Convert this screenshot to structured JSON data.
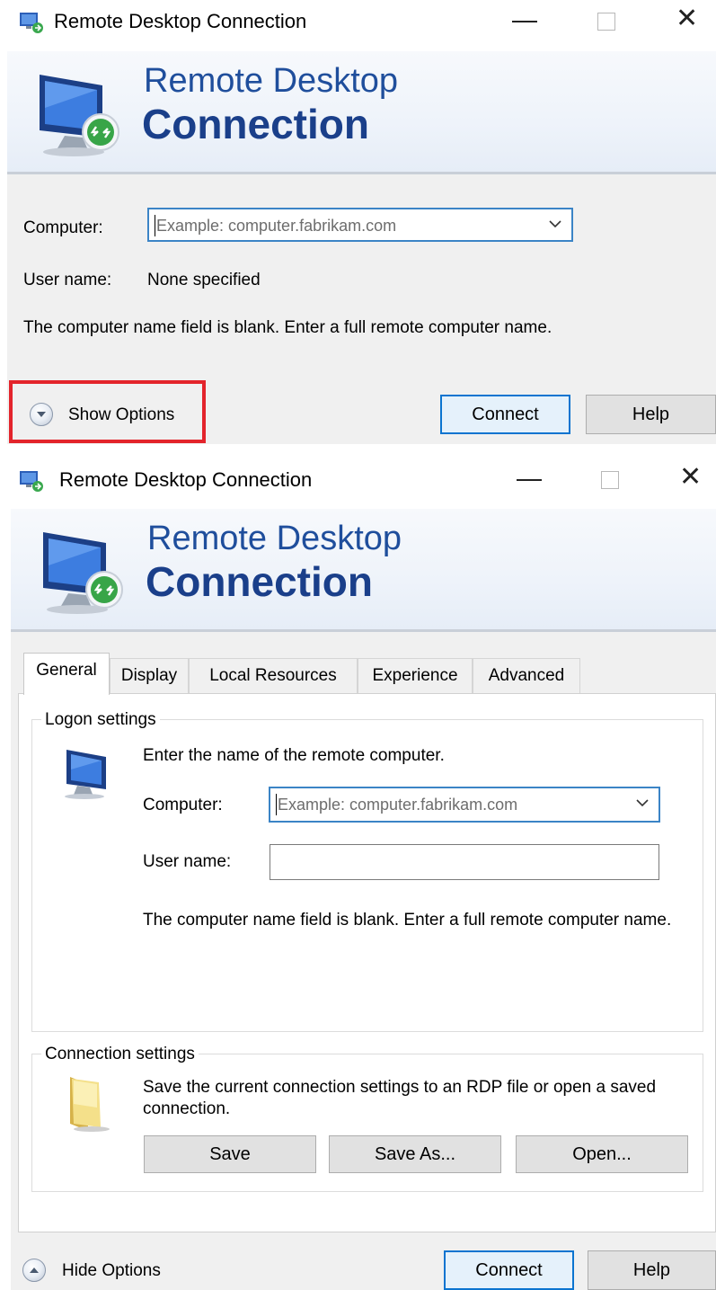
{
  "window": {
    "title": "Remote Desktop Connection"
  },
  "banner": {
    "line1": "Remote Desktop",
    "line2": "Connection"
  },
  "collapsed": {
    "computer_label": "Computer:",
    "computer_placeholder": "Example: computer.fabrikam.com",
    "username_label": "User name:",
    "username_value": "None specified",
    "message": "The computer name field is blank. Enter a full remote computer name.",
    "show_options": "Show Options",
    "connect": "Connect",
    "help": "Help"
  },
  "expanded": {
    "tabs": [
      "General",
      "Display",
      "Local Resources",
      "Experience",
      "Advanced"
    ],
    "logon": {
      "title": "Logon settings",
      "prompt": "Enter the name of the remote computer.",
      "computer_label": "Computer:",
      "computer_placeholder": "Example: computer.fabrikam.com",
      "username_label": "User name:",
      "username_value": "",
      "message": "The computer name field is blank. Enter a full remote computer name."
    },
    "connection": {
      "title": "Connection settings",
      "message": "Save the current connection settings to an RDP file or open a saved connection.",
      "save": "Save",
      "save_as": "Save As...",
      "open": "Open..."
    },
    "hide_options": "Hide Options",
    "connect": "Connect",
    "help": "Help"
  },
  "colors": {
    "accent": "#0b74d0",
    "banner_text": "#1f4e9c",
    "highlight": "#e3242b"
  }
}
